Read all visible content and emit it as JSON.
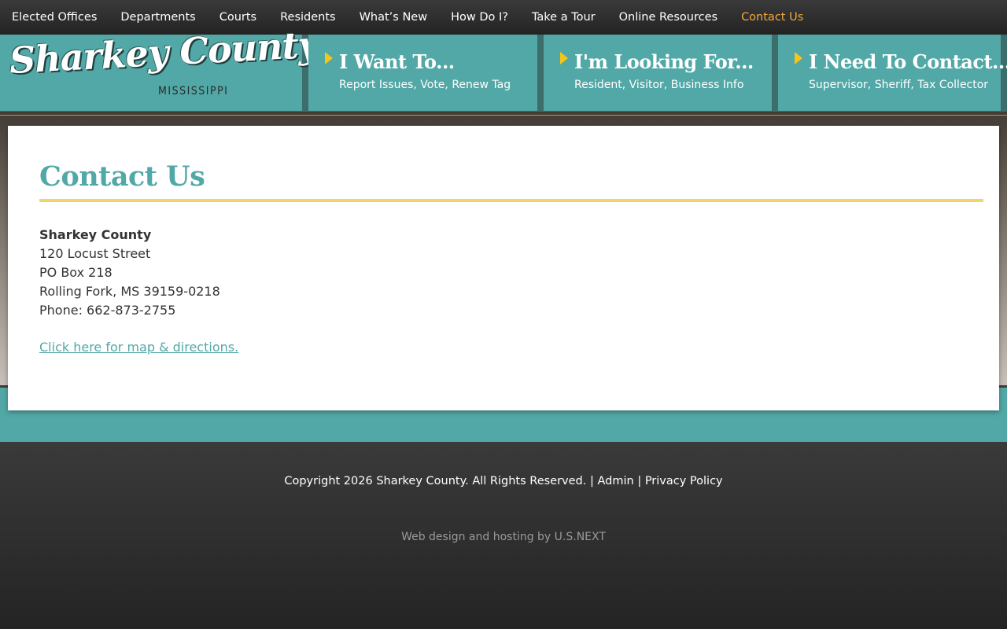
{
  "nav": {
    "items": [
      {
        "label": "Elected Offices",
        "active": false
      },
      {
        "label": "Departments",
        "active": false
      },
      {
        "label": "Courts",
        "active": false
      },
      {
        "label": "Residents",
        "active": false
      },
      {
        "label": "What’s New",
        "active": false
      },
      {
        "label": "How Do I?",
        "active": false
      },
      {
        "label": "Take a Tour",
        "active": false
      },
      {
        "label": "Online Resources",
        "active": false
      },
      {
        "label": "Contact Us",
        "active": true
      }
    ]
  },
  "logo": {
    "script": "Sharkey County",
    "state": "MISSISSIPPI"
  },
  "quick_links": [
    {
      "title": "I Want To...",
      "subtitle": "Report Issues, Vote, Renew Tag"
    },
    {
      "title": "I'm Looking For...",
      "subtitle": "Resident, Visitor, Business Info"
    },
    {
      "title": "I Need To Contact...",
      "subtitle": "Supervisor, Sheriff, Tax Collector"
    }
  ],
  "main": {
    "title": "Contact Us",
    "org": "Sharkey County",
    "street": "120 Locust Street",
    "po_box": "PO Box 218",
    "city": "Rolling Fork, MS 39159-0218",
    "phone": "Phone: 662-873-2755",
    "map_link": "Click here for map & directions."
  },
  "footer": {
    "copyright": "Copyright 2026 Sharkey County. All Rights Reserved.",
    "sep": "|",
    "admin": "Admin",
    "privacy": "Privacy Policy",
    "credit": "Web design and hosting by U.S.NEXT"
  },
  "colors": {
    "teal": "#52a8a6",
    "gold": "#f1d369",
    "nav_active": "#f2a93b",
    "arrow": "#f5c518"
  }
}
